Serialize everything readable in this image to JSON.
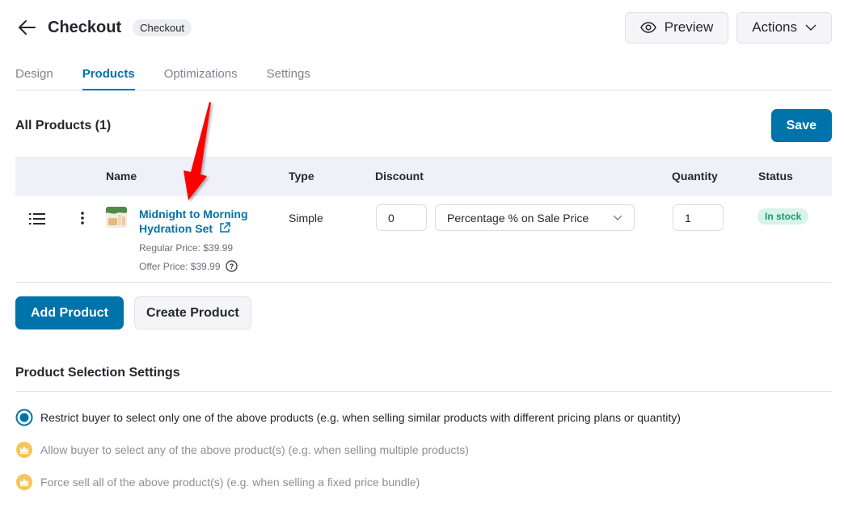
{
  "header": {
    "back_icon": "arrow-left-icon",
    "title": "Checkout",
    "badge": "Checkout",
    "preview_label": "Preview",
    "preview_icon": "eye-icon",
    "actions_label": "Actions",
    "actions_icon": "chevron-down-icon"
  },
  "tabs": [
    {
      "label": "Design",
      "active": false
    },
    {
      "label": "Products",
      "active": true
    },
    {
      "label": "Optimizations",
      "active": false
    },
    {
      "label": "Settings",
      "active": false
    }
  ],
  "products_section": {
    "title": "All Products (1)",
    "save_label": "Save"
  },
  "table": {
    "columns": [
      "Name",
      "Type",
      "Discount",
      "Quantity",
      "Status"
    ],
    "rows": [
      {
        "name": "Midnight to Morning Hydration Set",
        "type": "Simple",
        "regular_price": "Regular Price: $39.99",
        "offer_price": "Offer Price: $39.99",
        "discount_value": "0",
        "discount_type": "Percentage % on Sale Price",
        "quantity": "1",
        "status": "In stock"
      }
    ]
  },
  "actions": {
    "add_product": "Add Product",
    "create_product": "Create Product"
  },
  "selection_settings": {
    "title": "Product Selection Settings",
    "options": [
      {
        "label": "Restrict buyer to select only one of the above products (e.g. when selling similar products with different pricing plans or quantity)",
        "selected": true,
        "locked": false
      },
      {
        "label": "Allow buyer to select any of the above product(s) (e.g. when selling multiple products)",
        "selected": false,
        "locked": true
      },
      {
        "label": "Force sell all of the above product(s) (e.g. when selling a fixed price bundle)",
        "selected": false,
        "locked": true
      }
    ]
  },
  "colors": {
    "primary": "#0073aa",
    "status_bg": "#d7f3ea",
    "status_text": "#1a9a71",
    "premium": "#f7c55b",
    "annotation_arrow": "#ff0000"
  }
}
